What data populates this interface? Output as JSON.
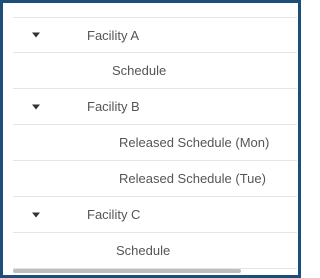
{
  "tree": {
    "facilities": [
      {
        "label": "Facility A",
        "expanded": true,
        "children": [
          {
            "label": "Schedule"
          }
        ]
      },
      {
        "label": "Facility B",
        "expanded": true,
        "children": [
          {
            "label": "Released Schedule (Mon)"
          },
          {
            "label": "Released Schedule (Tue)"
          }
        ]
      },
      {
        "label": "Facility C",
        "expanded": true,
        "children": [
          {
            "label": "Schedule"
          }
        ]
      }
    ]
  }
}
